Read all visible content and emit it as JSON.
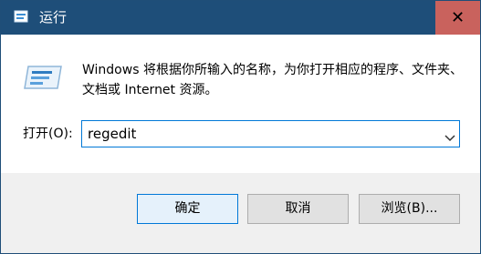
{
  "window": {
    "title": "运行",
    "close_glyph": "✕"
  },
  "prompt": {
    "text": "Windows 将根据你所输入的名称，为你打开相应的程序、文件夹、文档或 Internet 资源。"
  },
  "open": {
    "label": "打开(O):",
    "value": "regedit"
  },
  "buttons": {
    "ok": "确定",
    "cancel": "取消",
    "browse": "浏览(B)..."
  },
  "colors": {
    "titlebar": "#1e4e79",
    "close_hover": "#c9625d",
    "focus": "#0078d7"
  },
  "icons": {
    "app": "run-app-icon",
    "dialog": "run-dialog-icon",
    "dropdown": "chevron-down-icon",
    "close": "close-icon"
  }
}
